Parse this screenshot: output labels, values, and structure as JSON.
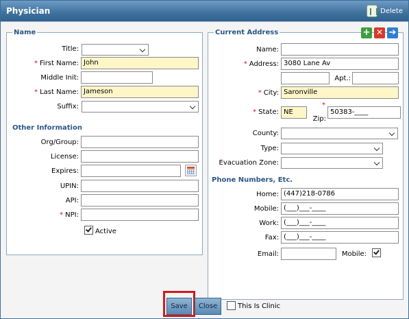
{
  "window": {
    "title": "Physician",
    "delete_label": "Delete"
  },
  "name_section": {
    "legend": "Name",
    "title_label": "Title:",
    "first_name_label": "First Name:",
    "first_name": "John",
    "middle_init_label": "Middle Init:",
    "middle_init": "",
    "last_name_label": "Last Name:",
    "last_name": "Jameson",
    "suffix_label": "Suffix:"
  },
  "other_info": {
    "heading": "Other Information",
    "org_group_label": "Org/Group:",
    "license_label": "License:",
    "expires_label": "Expires:",
    "upin_label": "UPIN:",
    "api_label": "API:",
    "npi_label": "NPI:",
    "active_label": "Active",
    "active_checked": true
  },
  "address": {
    "legend": "Current Address",
    "name_label": "Name:",
    "name": "",
    "address_label": "Address:",
    "address": "3080 Lane Av",
    "apt_label": "Apt.:",
    "apt": "",
    "city_label": "City:",
    "city": "Saronville",
    "state_label": "State:",
    "state": "NE",
    "zip_label": "Zip:",
    "zip": "50383-____",
    "county_label": "County:",
    "type_label": "Type:",
    "evacuation_zone_label": "Evacuation Zone:"
  },
  "phones": {
    "heading": "Phone Numbers, Etc.",
    "home_label": "Home:",
    "home": "(447)218-0786",
    "mobile_label": "Mobile:",
    "mobile": "(___)___-____",
    "work_label": "Work:",
    "work": "(___)___-____",
    "fax_label": "Fax:",
    "fax": "(___)___-____",
    "email_label": "Email:",
    "email": "",
    "email_mobile_label": "Mobile:",
    "email_mobile_checked": true
  },
  "footer": {
    "save_label": "Save",
    "close_label": "Close",
    "clinic_label": "This Is Clinic",
    "clinic_checked": false
  },
  "colors": {
    "titlebar": "#3f719d",
    "highlight": "#d11a1a",
    "required_field": "#fff6c8"
  }
}
